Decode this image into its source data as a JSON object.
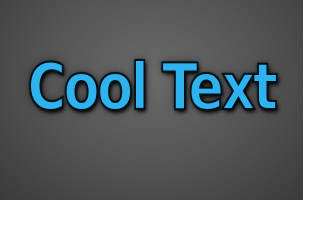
{
  "logo": {
    "text": "Cool Text"
  },
  "colors": {
    "text_fill": "#2fb3ee",
    "text_outline": "#001018",
    "background_center": "#6a6a6a",
    "background_edge": "#2a2a2a"
  }
}
